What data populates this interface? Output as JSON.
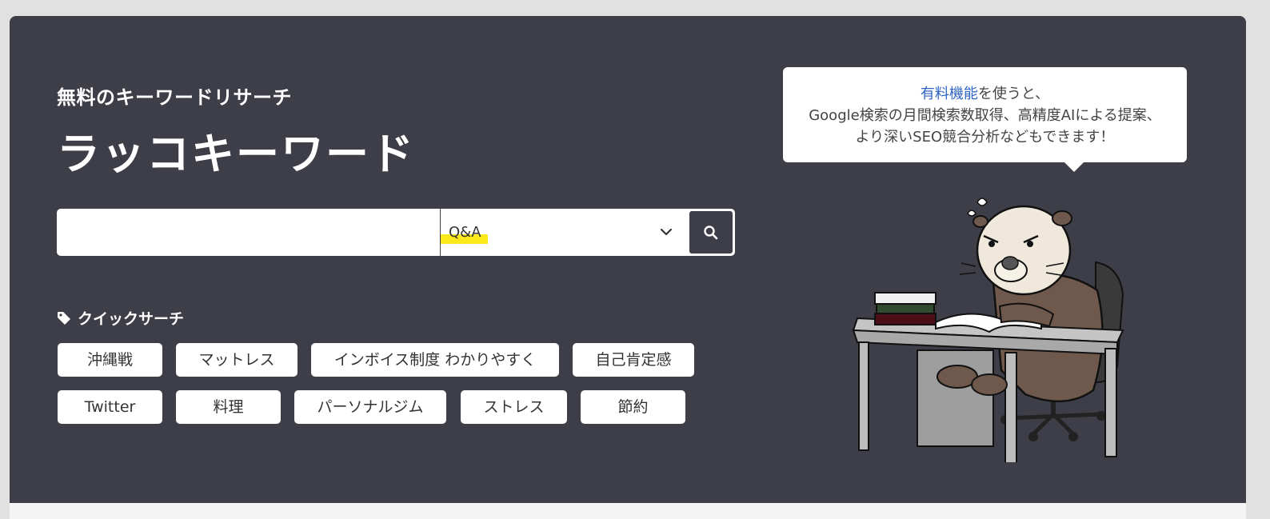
{
  "hero": {
    "subtitle": "無料のキーワードリサーチ",
    "title": "ラッコキーワード"
  },
  "search": {
    "input_value": "",
    "input_placeholder": "",
    "mode_selected": "Q&A",
    "search_icon": "search-icon",
    "dropdown_icon": "chevron-down-icon"
  },
  "quick_search": {
    "label": "クイックサーチ",
    "icon": "tag-icon",
    "chips": [
      "沖縄戦",
      "マットレス",
      "インボイス制度 わかりやすく",
      "自己肯定感",
      "Twitter",
      "料理",
      "パーソナルジム",
      "ストレス",
      "節約"
    ]
  },
  "promo": {
    "link_text": "有料機能",
    "line1_suffix": "を使うと、",
    "line2": "Google検索の月間検索数取得、高精度AIによる提案、",
    "line3": "より深いSEO競合分析などもできます！"
  },
  "colors": {
    "hero_bg": "#3e3e48",
    "highlight": "#fbe91c",
    "link": "#2f66c6"
  }
}
